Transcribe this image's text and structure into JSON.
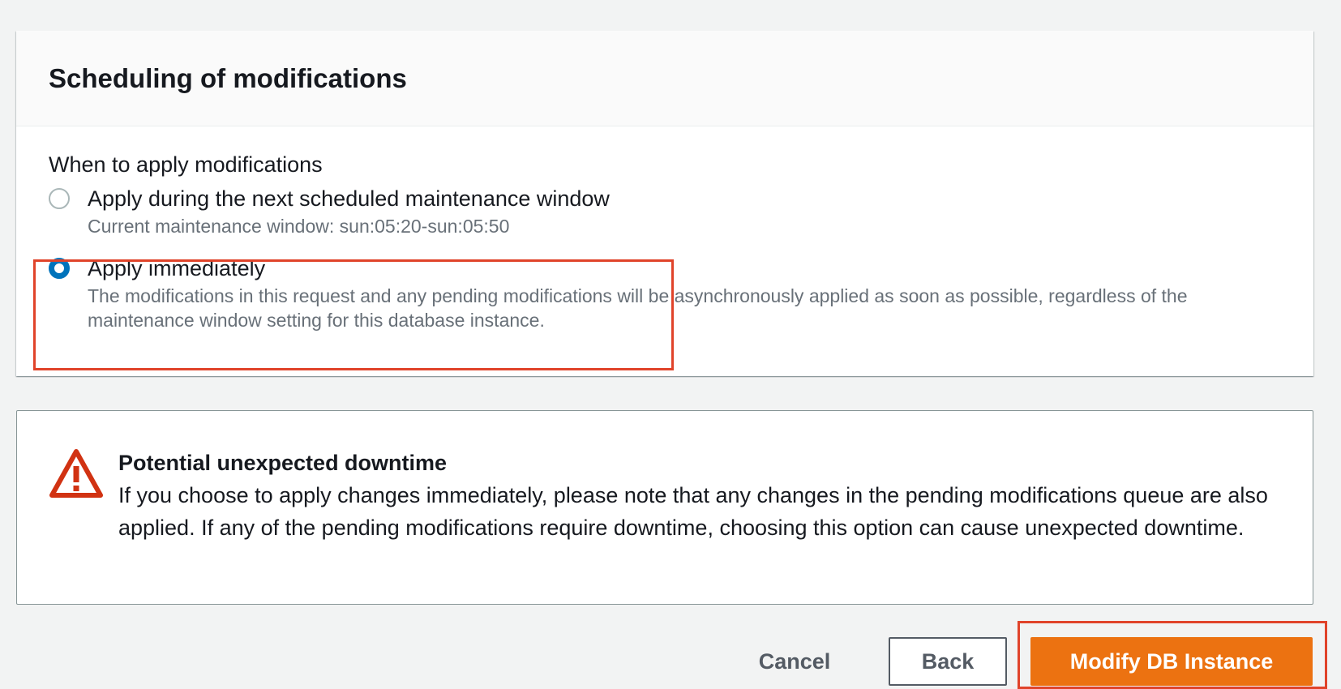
{
  "scheduling": {
    "title": "Scheduling of modifications",
    "field_label": "When to apply modifications",
    "options": [
      {
        "label": "Apply during the next scheduled maintenance window",
        "description": "Current maintenance window: sun:05:20-sun:05:50",
        "selected": false
      },
      {
        "label": "Apply immediately",
        "description": "The modifications in this request and any pending modifications will be asynchronously applied as soon as possible, regardless of the maintenance window setting for this database instance.",
        "selected": true
      }
    ]
  },
  "alert": {
    "icon": "warning-triangle-icon",
    "title": "Potential unexpected downtime",
    "text": "If you choose to apply changes immediately, please note that any changes in the pending modifications queue are also applied. If any of the pending modifications require downtime, choosing this option can cause unexpected downtime."
  },
  "footer": {
    "cancel_label": "Cancel",
    "back_label": "Back",
    "primary_label": "Modify DB Instance"
  },
  "colors": {
    "accent": "#ec7211",
    "radio_selected": "#0073bb",
    "warning": "#d13212",
    "highlight_box": "#e0432a"
  }
}
